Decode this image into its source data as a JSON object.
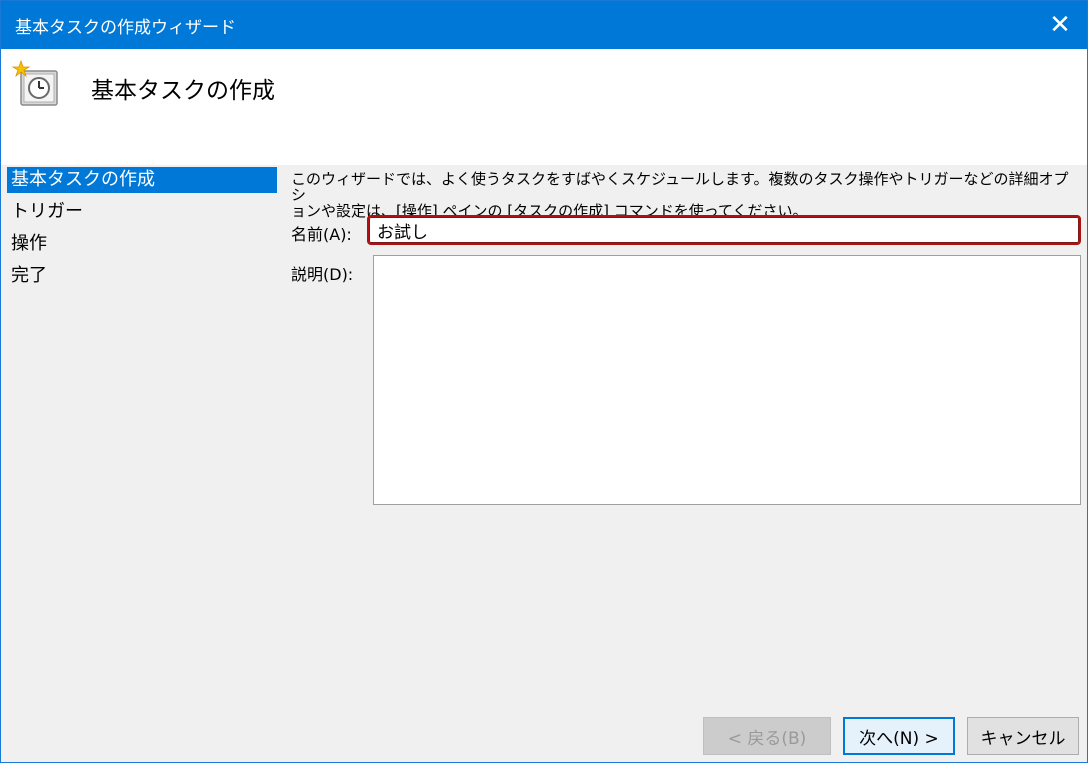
{
  "window": {
    "title": "基本タスクの作成ウィザード",
    "close_glyph": "✕"
  },
  "header": {
    "title": "基本タスクの作成",
    "icon": "task-scheduler-clock-icon"
  },
  "nav": {
    "items": [
      {
        "label": "基本タスクの作成",
        "active": true
      },
      {
        "label": "トリガー",
        "active": false
      },
      {
        "label": "操作",
        "active": false
      },
      {
        "label": "完了",
        "active": false
      }
    ]
  },
  "content": {
    "description_line1": "このウィザードでは、よく使うタスクをすばやくスケジュールします。複数のタスク操作やトリガーなどの詳細オプシ",
    "description_line2": "ョンや設定は、[操作] ペインの [タスクの作成] コマンドを使ってください。",
    "name_label": "名前(A):",
    "name_value": "お試し",
    "desc_label": "説明(D):",
    "desc_value": ""
  },
  "buttons": {
    "back": "< 戻る(B)",
    "next": "次へ(N) >",
    "cancel": "キャンセル"
  },
  "colors": {
    "titlebar": "#0078d7",
    "nav_active": "#0078d7",
    "name_border": "#b01010"
  }
}
